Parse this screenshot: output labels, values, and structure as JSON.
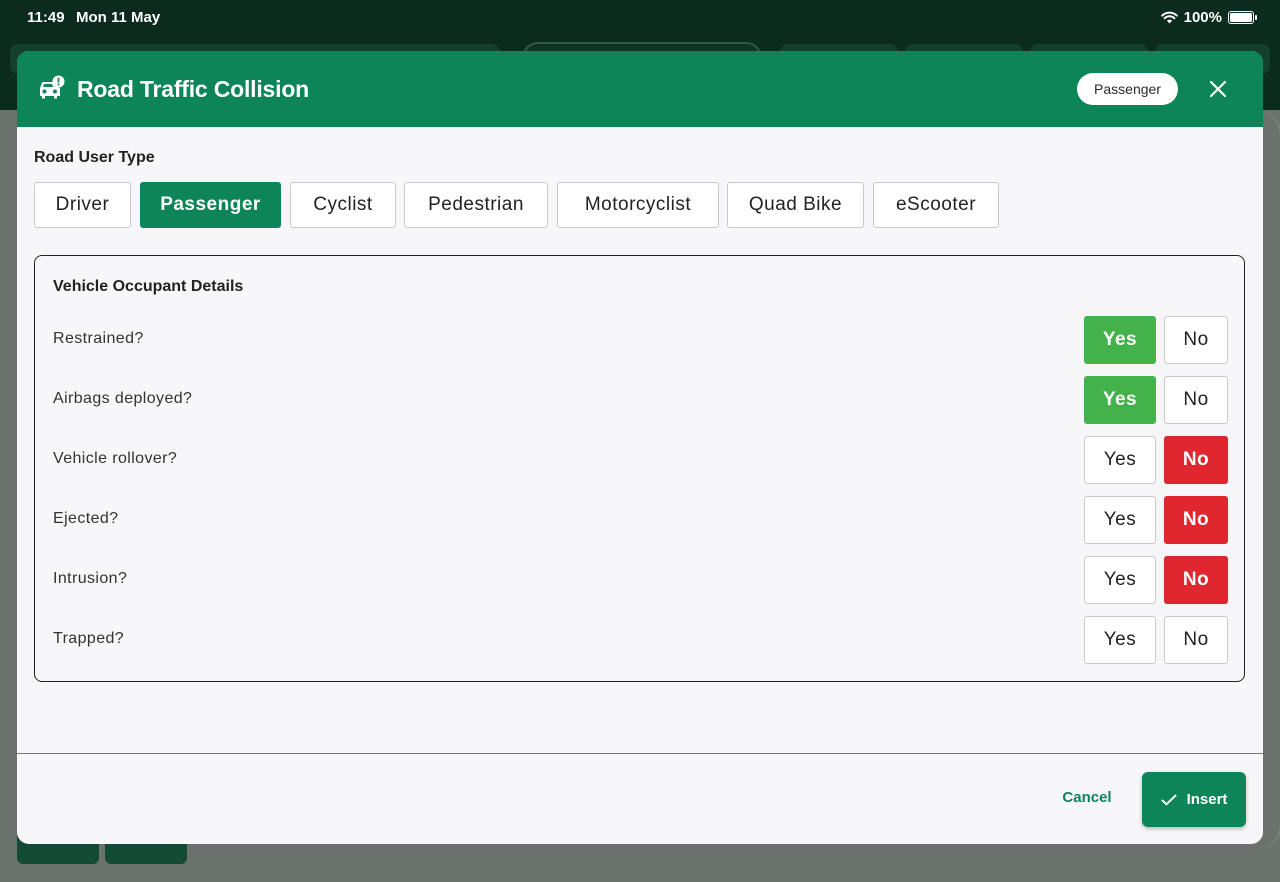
{
  "status_bar": {
    "time": "11:49",
    "date": "Mon 11 May",
    "battery": "100%"
  },
  "modal": {
    "title": "Road Traffic Collision",
    "header_chip": "Passenger",
    "icons": {
      "header": "car-alert-icon",
      "close": "close-icon"
    }
  },
  "road_user": {
    "label": "Road User Type",
    "selected": "Passenger",
    "options": [
      "Driver",
      "Passenger",
      "Cyclist",
      "Pedestrian",
      "Motorcyclist",
      "Quad Bike",
      "eScooter"
    ]
  },
  "occupant": {
    "title": "Vehicle Occupant Details",
    "yes_label": "Yes",
    "no_label": "No",
    "questions": [
      {
        "label": "Restrained?",
        "answer": "yes"
      },
      {
        "label": "Airbags deployed?",
        "answer": "yes"
      },
      {
        "label": "Vehicle rollover?",
        "answer": "no"
      },
      {
        "label": "Ejected?",
        "answer": "no"
      },
      {
        "label": "Intrusion?",
        "answer": "no"
      },
      {
        "label": "Trapped?",
        "answer": ""
      }
    ]
  },
  "footer": {
    "cancel": "Cancel",
    "insert": "Insert"
  },
  "colors": {
    "header_green": "#0e8459",
    "yes_green": "#44b24b",
    "no_red": "#e0262f"
  }
}
